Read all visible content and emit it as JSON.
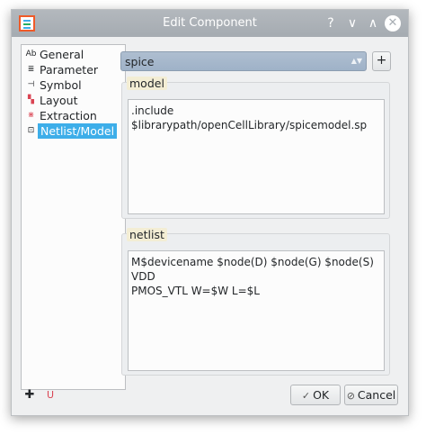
{
  "window": {
    "title": "Edit Component"
  },
  "titlebar": {
    "help_glyph": "?",
    "minimize_glyph": "∨",
    "maximize_glyph": "∧",
    "close_glyph": "✕"
  },
  "sidebar": {
    "items": [
      {
        "label": "General",
        "icon": "text-ab-icon",
        "glyph": "Ab"
      },
      {
        "label": "Parameter",
        "icon": "list-icon",
        "glyph": "≣"
      },
      {
        "label": "Symbol",
        "icon": "symbol-icon",
        "glyph": "⊣"
      },
      {
        "label": "Layout",
        "icon": "layout-icon",
        "glyph": "▚"
      },
      {
        "label": "Extraction",
        "icon": "extraction-icon",
        "glyph": "⋇"
      },
      {
        "label": "Netlist/Model",
        "icon": "netlist-icon",
        "glyph": "⊡"
      }
    ],
    "selected": "Netlist/Model"
  },
  "selector": {
    "value": "spice",
    "arrow": "▲▼",
    "add_label": "+"
  },
  "model": {
    "label": "model",
    "text": ".include\n$librarypath/openCellLibrary/spicemodel.sp"
  },
  "netlist": {
    "label": "netlist",
    "text": "M$devicename $node(D) $node(G) $node(S) VDD\nPMOS_VTL W=$W L=$L"
  },
  "footer": {
    "add_glyph": "✚",
    "magnet_glyph": "U",
    "ok_label": "OK",
    "ok_glyph": "✓",
    "cancel_label": "Cancel",
    "cancel_glyph": "⊘"
  },
  "colors": {
    "accent": "#3daee9",
    "titlebar": "#a9afb5",
    "group_label_bg": "#f3edd4",
    "combo": "#a4b6ca"
  }
}
